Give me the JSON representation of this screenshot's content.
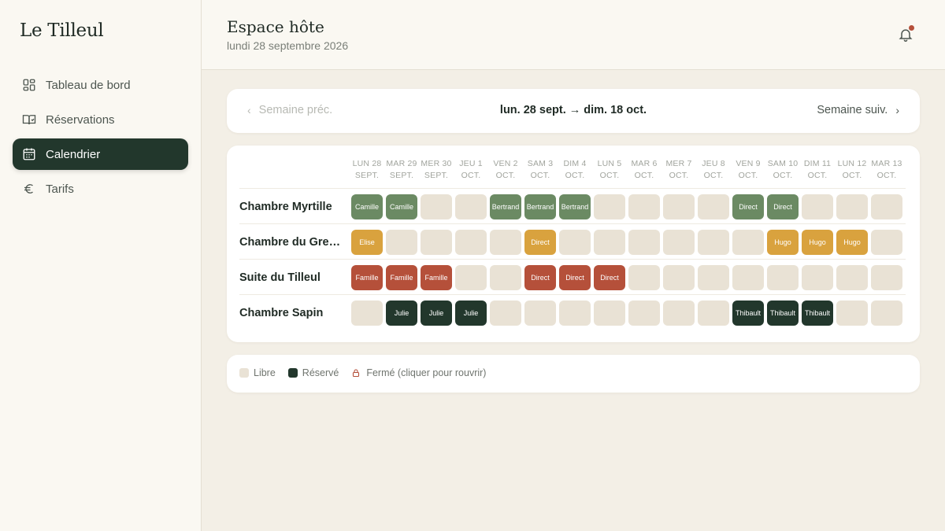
{
  "sidebar": {
    "brand": "Le Tilleul",
    "items": [
      {
        "label": "Tableau de bord",
        "icon": "dashboard-icon",
        "active": false
      },
      {
        "label": "Réservations",
        "icon": "book-icon",
        "active": false
      },
      {
        "label": "Calendrier",
        "icon": "calendar-icon",
        "active": true
      },
      {
        "label": "Tarifs",
        "icon": "euro-icon",
        "active": false
      }
    ]
  },
  "header": {
    "title": "Espace hôte",
    "date": "lundi 28 septembre 2026",
    "notification_icon": "bell-icon"
  },
  "week_nav": {
    "prev_label": "Semaine préc.",
    "range": "lun. 28 sept. → dim. 18 oct.",
    "next_label": "Semaine suiv."
  },
  "calendar": {
    "days": [
      {
        "day": "LUN 28",
        "month": "SEPT."
      },
      {
        "day": "MAR 29",
        "month": "SEPT."
      },
      {
        "day": "MER 30",
        "month": "SEPT."
      },
      {
        "day": "JEU 1",
        "month": "OCT."
      },
      {
        "day": "VEN 2",
        "month": "OCT."
      },
      {
        "day": "SAM 3",
        "month": "OCT."
      },
      {
        "day": "DIM 4",
        "month": "OCT."
      },
      {
        "day": "LUN 5",
        "month": "OCT."
      },
      {
        "day": "MAR 6",
        "month": "OCT."
      },
      {
        "day": "MER 7",
        "month": "OCT."
      },
      {
        "day": "JEU 8",
        "month": "OCT."
      },
      {
        "day": "VEN 9",
        "month": "OCT."
      },
      {
        "day": "SAM 10",
        "month": "OCT."
      },
      {
        "day": "DIM 11",
        "month": "OCT."
      },
      {
        "day": "LUN 12",
        "month": "OCT."
      },
      {
        "day": "MAR 13",
        "month": "OCT."
      },
      {
        "day": "",
        "month": ""
      }
    ],
    "rooms": [
      {
        "name": "Chambre Myrtille",
        "color": "#6b8a63",
        "cells": [
          "Camille",
          "Camille",
          "",
          "",
          "Bertrand",
          "Bertrand",
          "Bertrand",
          "",
          "",
          "",
          "",
          "Direct",
          "Direct",
          "",
          "",
          "",
          ""
        ]
      },
      {
        "name": "Chambre du Grenier",
        "color": "#d9a23e",
        "cells": [
          "Elise",
          "",
          "",
          "",
          "",
          "Direct",
          "",
          "",
          "",
          "",
          "",
          "",
          "Hugo",
          "Hugo",
          "Hugo",
          "",
          ""
        ]
      },
      {
        "name": "Suite du Tilleul",
        "color": "#b5503a",
        "cells": [
          "Famille",
          "Famille",
          "Famille",
          "",
          "",
          "Direct",
          "Direct",
          "Direct",
          "",
          "",
          "",
          "",
          "",
          "",
          "",
          "",
          ""
        ]
      },
      {
        "name": "Chambre Sapin",
        "color": "#22372c",
        "cells": [
          "",
          "Julie",
          "Julie",
          "Julie",
          "",
          "",
          "",
          "",
          "",
          "",
          "",
          "Thibault",
          "Thibault",
          "Thibault",
          "",
          "",
          "·"
        ]
      }
    ],
    "free_color": "#e9e2d5"
  },
  "legend": {
    "free_label": "Libre",
    "reserved_label": "Réservé",
    "closed_label": "Fermé (cliquer pour rouvrir)",
    "free_color": "#e9e2d5",
    "reserved_color": "#22372c",
    "closed_color": "#b5503a"
  }
}
